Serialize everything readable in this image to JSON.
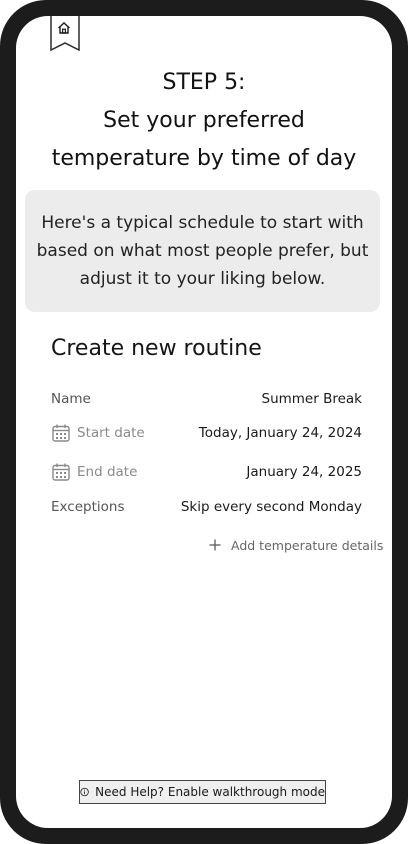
{
  "header": {
    "step": "STEP 5:",
    "title_line1": "Set your preferred",
    "title_line2": "temperature by time of day"
  },
  "intro": {
    "line1": "Here's a typical schedule to start with",
    "line2": "based on what most people prefer, but",
    "line3": "adjust it to your liking below."
  },
  "routine": {
    "heading": "Create new routine",
    "name_label": "Name",
    "name_value": "Summer Break",
    "start_label": "Start date",
    "start_value": "Today, January 24, 2024",
    "end_label": "End date",
    "end_value": "January 24, 2025",
    "exceptions_label": "Exceptions",
    "exceptions_value": "Skip every second Monday",
    "add_label": "Add temperature details"
  },
  "help": {
    "label": "Need Help? Enable walkthrough mode"
  },
  "icons": [
    "home-icon",
    "calendar-icon",
    "plus-icon",
    "info-icon"
  ]
}
